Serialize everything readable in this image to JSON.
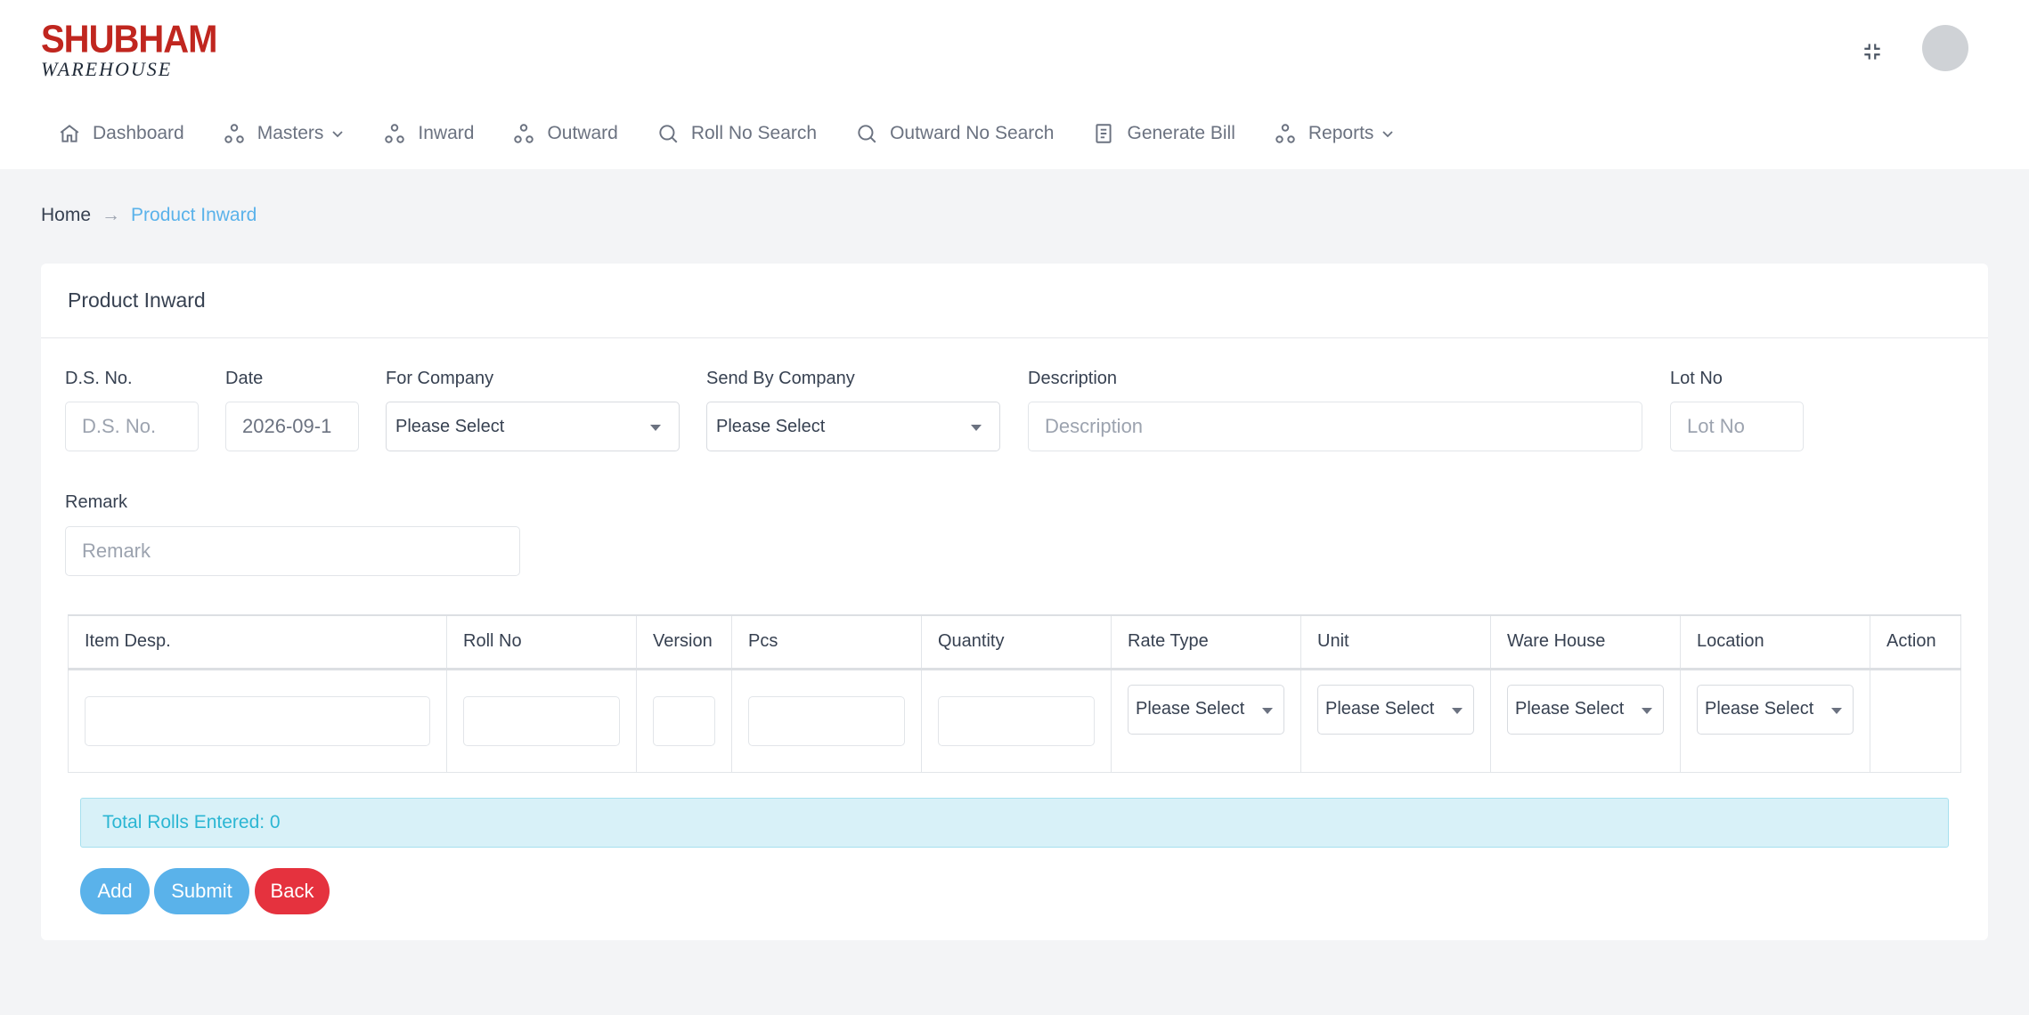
{
  "brand": {
    "line1": "SHUBHAM",
    "line2": "WAREHOUSE"
  },
  "header": {
    "fullscreen_icon": "fullscreen-exit-icon"
  },
  "nav": {
    "items": [
      {
        "label": "Dashboard",
        "icon": "home-icon"
      },
      {
        "label": "Masters",
        "icon": "nodes-icon",
        "dropdown": true
      },
      {
        "label": "Inward",
        "icon": "nodes-icon"
      },
      {
        "label": "Outward",
        "icon": "nodes-icon"
      },
      {
        "label": "Roll No Search",
        "icon": "search-icon"
      },
      {
        "label": "Outward No Search",
        "icon": "search-icon"
      },
      {
        "label": "Generate Bill",
        "icon": "document-icon"
      },
      {
        "label": "Reports",
        "icon": "nodes-icon",
        "dropdown": true
      }
    ]
  },
  "breadcrumb": {
    "home": "Home",
    "separator": "→",
    "current": "Product Inward"
  },
  "card": {
    "title": "Product Inward",
    "form": {
      "ds_no": {
        "label": "D.S. No.",
        "placeholder": "D.S. No.",
        "value": ""
      },
      "date": {
        "label": "Date",
        "value": "2026-09-1"
      },
      "for_company": {
        "label": "For Company",
        "value": "Please Select"
      },
      "send_by_company": {
        "label": "Send By Company",
        "value": "Please Select"
      },
      "description": {
        "label": "Description",
        "placeholder": "Description",
        "value": ""
      },
      "lot_no": {
        "label": "Lot No",
        "placeholder": "Lot No",
        "value": ""
      },
      "remark": {
        "label": "Remark",
        "placeholder": "Remark",
        "value": ""
      }
    },
    "table": {
      "headers": [
        "Item Desp.",
        "Roll No",
        "Version",
        "Pcs",
        "Quantity",
        "Rate Type",
        "Unit",
        "Ware House",
        "Location",
        "Action"
      ],
      "row": {
        "rate_type": "Please Select",
        "unit": "Please Select",
        "ware_house": "Please Select",
        "location": "Please Select"
      }
    },
    "total_rolls": "Total Rolls Entered: 0",
    "buttons": {
      "add": "Add",
      "submit": "Submit",
      "back": "Back"
    }
  },
  "colors": {
    "brand_red": "#c0261f",
    "primary": "#5ab2ea",
    "danger": "#e5323e",
    "info_bg": "#d8f1f8",
    "info_text": "#2bb6d3"
  }
}
